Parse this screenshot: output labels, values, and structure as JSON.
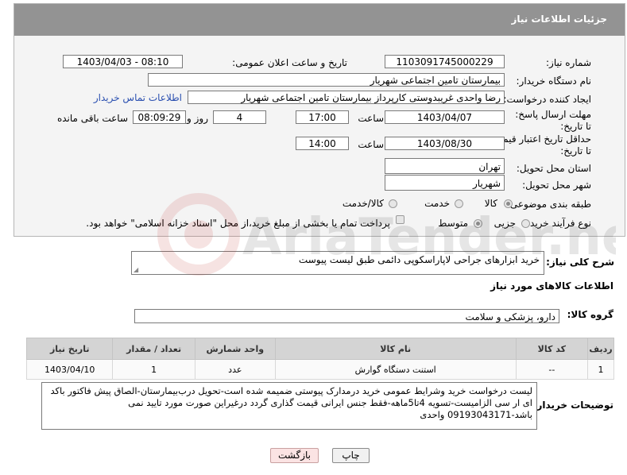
{
  "panel_title": "جزئیات اطلاعات نیاز",
  "need_number": {
    "label": "شماره نیاز:",
    "value": "1103091745000229"
  },
  "announce_datetime": {
    "label": "تاریخ و ساعت اعلان عمومی:",
    "value": "1403/04/03 - 08:10"
  },
  "buyer_org": {
    "label": "نام دستگاه خریدار:",
    "value": "بیمارستان تامین اجتماعی شهریار"
  },
  "requester": {
    "label": "ایجاد کننده درخواست:",
    "value": "رضا واحدی غریبدوستی کارپرداز بیمارستان تامین اجتماعی شهریار",
    "contact_link": "اطلاعات تماس خریدار"
  },
  "reply_deadline": {
    "label": "مهلت ارسال پاسخ: تا تاریخ:",
    "date": "1403/04/07",
    "time_label": "ساعت",
    "time": "17:00",
    "days": "4",
    "days_label": "روز و",
    "remaining": "08:09:29",
    "remaining_label": "ساعت باقی مانده"
  },
  "price_validity": {
    "label": "حداقل تاریخ اعتبار قیمت: تا تاریخ:",
    "date": "1403/08/30",
    "time_label": "ساعت",
    "time": "14:00"
  },
  "delivery_province": {
    "label": "استان محل تحویل:",
    "value": "تهران"
  },
  "delivery_city": {
    "label": "شهر محل تحویل:",
    "value": "شهریار"
  },
  "category": {
    "label": "طبقه بندی موضوعی:",
    "options": [
      "کالا",
      "خدمت",
      "کالا/خدمت"
    ],
    "selected": "کالا"
  },
  "process_type": {
    "label": "نوع فرآیند خرید :",
    "options": [
      "جزیی",
      "متوسط"
    ],
    "selected": "متوسط",
    "payment_note": "پرداخت تمام یا بخشی از مبلغ خرید،از محل \"اسناد خزانه اسلامی\" خواهد بود."
  },
  "description": {
    "label": "شرح کلی نیاز:",
    "value": "خرید ابزارهای جراحی لاپاراسکوپی دائمی طبق لیست پیوست"
  },
  "goods_info_title": "اطلاعات کالاهای مورد نیاز",
  "goods_group": {
    "label": "گروه کالا:",
    "value": "دارو، پزشکی و سلامت"
  },
  "table": {
    "headers": [
      "ردیف",
      "کد کالا",
      "نام کالا",
      "واحد شمارش",
      "تعداد / مقدار",
      "تاریخ نیاز"
    ],
    "rows": [
      [
        "1",
        "--",
        "استنت دستگاه گوارش",
        "عدد",
        "1",
        "1403/04/10"
      ]
    ]
  },
  "buyer_notes": {
    "label": "توضیحات خریدار:",
    "value": "لیست درخواست خرید وشرایط عمومی خرید درمدارک پیوستی ضمیمه شده است-تحویل درب‌بیمارستان-الصاق پیش فاکتور باکد ای ار سی الزامیست-تسویه 4تا5ماهه-فقط جنس ایرانی قیمت گذاری گردد درغیراین صورت مورد تایید نمی باشد-09193043171 واحدی"
  },
  "buttons": {
    "print": "چاپ",
    "back": "بازگشت"
  },
  "watermark_text": "AriaTender.neT"
}
